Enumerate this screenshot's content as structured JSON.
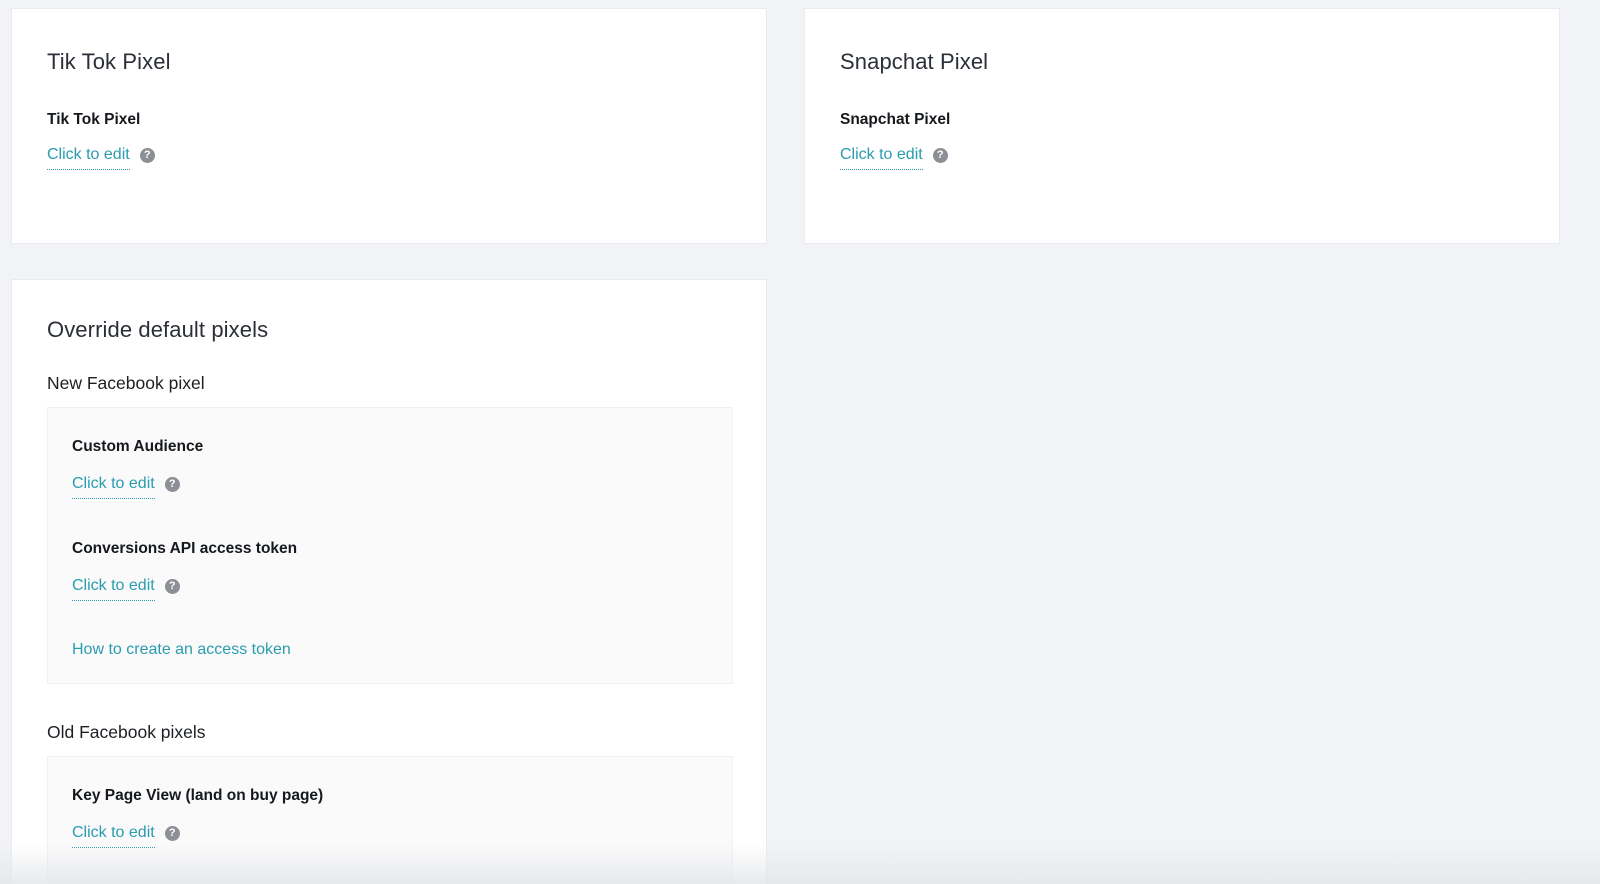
{
  "tiktok": {
    "card_title": "Tik Tok Pixel",
    "field_label": "Tik Tok Pixel",
    "edit_label": "Click to edit",
    "help_icon": "question-circle-icon"
  },
  "snapchat": {
    "card_title": "Snapchat Pixel",
    "field_label": "Snapchat Pixel",
    "edit_label": "Click to edit",
    "help_icon": "question-circle-icon"
  },
  "override": {
    "card_title": "Override default pixels",
    "new_facebook": {
      "heading": "New Facebook pixel",
      "fields": [
        {
          "label": "Custom Audience",
          "edit_label": "Click to edit"
        },
        {
          "label": "Conversions API access token",
          "edit_label": "Click to edit"
        }
      ],
      "help_link": "How to create an access token"
    },
    "old_facebook": {
      "heading": "Old Facebook pixels",
      "fields": [
        {
          "label": "Key Page View (land on buy page)",
          "edit_label": "Click to edit"
        }
      ]
    }
  },
  "colors": {
    "background": "#f1f3f6",
    "card": "#ffffff",
    "link": "#2a9cae",
    "help_icon": "#8c9096"
  }
}
